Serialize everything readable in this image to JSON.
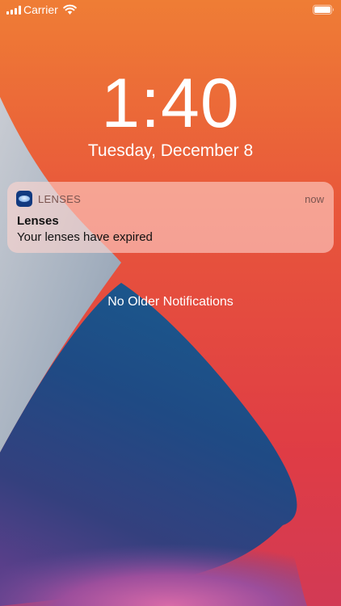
{
  "status_bar": {
    "carrier": "Carrier"
  },
  "lock_screen": {
    "time": "1:40",
    "date": "Tuesday, December 8"
  },
  "notification": {
    "app_name": "LENSES",
    "timestamp": "now",
    "title": "Lenses",
    "body": "Your lenses have expired",
    "app_icon": "contact-lens-icon"
  },
  "notification_center": {
    "empty_text": "No Older Notifications"
  },
  "colors": {
    "wallpaper_orange": "#ee7a36",
    "wallpaper_red": "#e23b3e",
    "wallpaper_blue": "#1e4f88",
    "wallpaper_gray": "#9eacbd",
    "notification_bg": "#ffd6ce",
    "app_icon_bg": "#123a80"
  }
}
